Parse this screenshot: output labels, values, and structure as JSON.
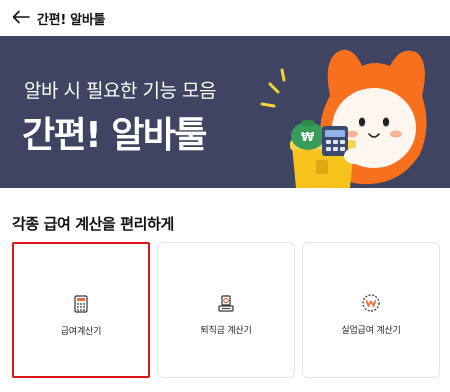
{
  "header": {
    "back_icon": "arrow-left-icon",
    "title": "간편! 알바툴"
  },
  "banner": {
    "subtitle": "알바 시 필요한 기능 모음",
    "title": "간편! 알바툴",
    "background_color": "#3e4461",
    "mascot_color": "#f7701e"
  },
  "section": {
    "title": "각종 급여 계산을 편리하게"
  },
  "cards": [
    {
      "label": "급여계산기",
      "icon": "calculator-icon",
      "selected": true
    },
    {
      "label": "퇴직금 계산기",
      "icon": "retirement-icon",
      "selected": false
    },
    {
      "label": "실업급여 계산기",
      "icon": "won-coin-icon",
      "selected": false
    }
  ],
  "colors": {
    "selection_outline": "#e0141a"
  }
}
